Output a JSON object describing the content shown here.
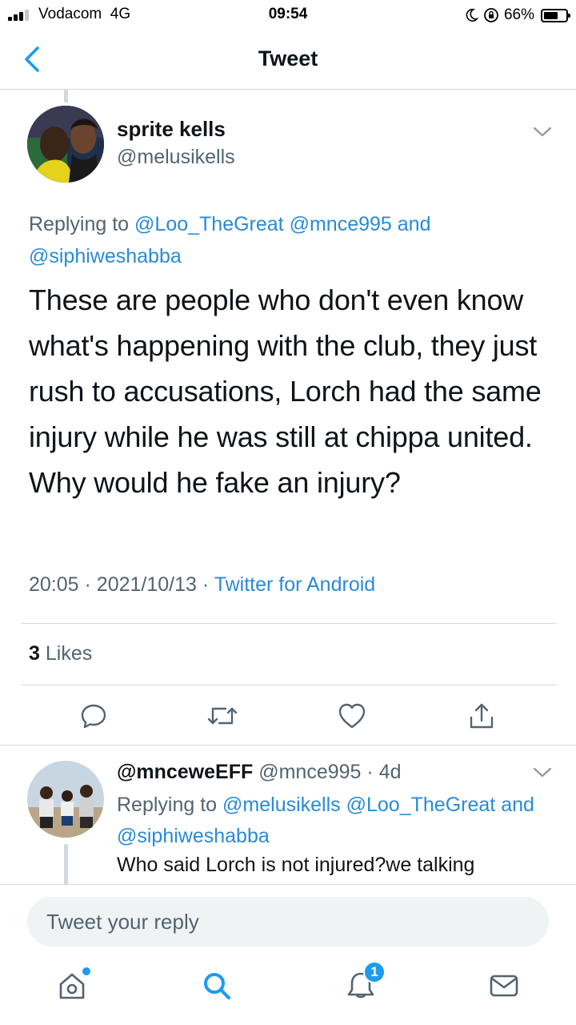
{
  "status_bar": {
    "carrier": "Vodacom",
    "network": "4G",
    "time": "09:54",
    "battery": "66%",
    "battery_level": 0.66
  },
  "header": {
    "title": "Tweet"
  },
  "main_tweet": {
    "author_name": "sprite kells",
    "author_handle": "@melusikells",
    "replying_prefix": "Replying to",
    "reply_to_1": "@Loo_TheGreat",
    "reply_to_2": "@mnce995",
    "reply_and": "and",
    "reply_to_3": "@siphiweshabba",
    "text": "These are people who don't even know what's happening with the club, they just rush to accusations, Lorch had the same injury while he was still at chippa united. Why would he fake an injury?",
    "time": "20:05",
    "date": "2021/10/13",
    "sep": "·",
    "source": "Twitter for Android",
    "likes_count": "3",
    "likes_label": "Likes"
  },
  "reply_tweet": {
    "author_name": "@mnceweEFF",
    "author_handle": "@mnce995",
    "sep": "·",
    "age": "4d",
    "replying_prefix": "Replying to",
    "reply_to_1": "@melusikells",
    "reply_to_2": "@Loo_TheGreat",
    "reply_and": "and",
    "reply_to_3": "@siphiweshabba",
    "text": "Who said Lorch is not injured?we talking"
  },
  "composer": {
    "placeholder": "Tweet your reply"
  },
  "tab_bar": {
    "notifications_badge": "1"
  },
  "icons": [
    "back-icon",
    "chevron-down-icon",
    "reply-icon",
    "retweet-icon",
    "like-icon",
    "share-icon",
    "home-icon",
    "search-icon",
    "notifications-icon",
    "messages-icon"
  ],
  "colors": {
    "accent": "#1d9bf0",
    "link": "#2a8ad8",
    "text_primary": "#0f1419",
    "text_secondary": "#536471",
    "divider": "#d9d9d9"
  }
}
